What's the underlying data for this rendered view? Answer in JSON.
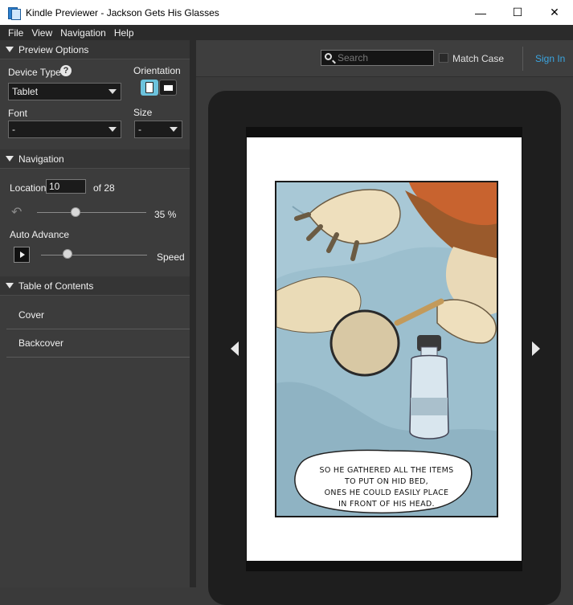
{
  "window": {
    "title": "Kindle Previewer - Jackson Gets His Glasses",
    "minimize_glyph": "—",
    "maximize_glyph": "☐",
    "close_glyph": "✕"
  },
  "menu": [
    "File",
    "View",
    "Navigation",
    "Help"
  ],
  "preview_options": {
    "header": "Preview Options",
    "device_type_label": "Device Type",
    "device_type_value": "Tablet",
    "orientation_label": "Orientation",
    "font_label": "Font",
    "font_value": "-",
    "size_label": "Size",
    "size_value": "-"
  },
  "navigation": {
    "header": "Navigation",
    "location_label": "Location",
    "location_value": "10",
    "location_total": "of 28",
    "progress_percent": 35,
    "progress_text": "35 %",
    "auto_advance_label": "Auto Advance",
    "speed_label": "Speed",
    "speed_fraction": 0.25
  },
  "toc": {
    "header": "Table of Contents",
    "items": [
      "Cover",
      "Backcover"
    ]
  },
  "toolbar": {
    "search_placeholder": "Search",
    "match_case": "Match Case",
    "sign_in": "Sign In"
  },
  "comic": {
    "caption_lines": [
      "SO HE GATHERED ALL THE ITEMS",
      "TO PUT ON HID BED,",
      "ONES HE COULD EASILY PLACE",
      "IN FRONT OF HIS HEAD."
    ]
  },
  "colors": {
    "accent": "#6cc3dd",
    "link": "#3ba5e0",
    "panel_bg": "#3c3c3c"
  }
}
